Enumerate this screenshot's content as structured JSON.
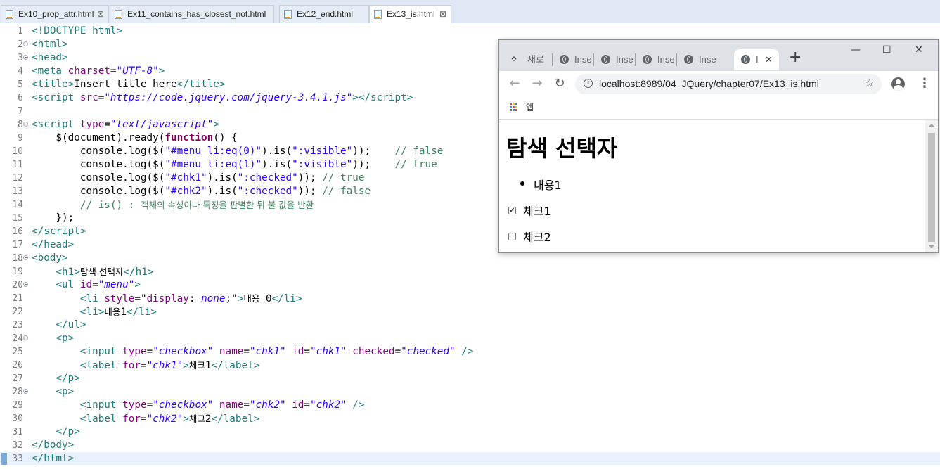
{
  "editor_tabs": [
    {
      "label": "Ex10_prop_attr.html",
      "close": "⊠"
    },
    {
      "label": "Ex11_contains_has_closest_not.html"
    },
    {
      "label": "Ex12_end.html"
    },
    {
      "label": "Ex13_is.html",
      "close": "⊠",
      "active": true
    }
  ],
  "editor": {
    "line_numbers": [
      "1",
      "2",
      "3",
      "4",
      "5",
      "6",
      "7",
      "8",
      "9",
      "10",
      "11",
      "12",
      "13",
      "14",
      "15",
      "16",
      "17",
      "18",
      "19",
      "20",
      "21",
      "22",
      "23",
      "24",
      "25",
      "26",
      "27",
      "28",
      "29",
      "30",
      "31",
      "32",
      "33"
    ],
    "current_line": "33"
  },
  "browser": {
    "tabs": [
      {
        "label": "새로",
        "icon": "apps-dots-icon"
      },
      {
        "label": "Inse",
        "icon": "globe-icon"
      },
      {
        "label": "Inse",
        "icon": "globe-icon"
      },
      {
        "label": "Inse",
        "icon": "globe-icon"
      },
      {
        "label": "Inse",
        "icon": "globe-icon"
      },
      {
        "label": "I",
        "icon": "globe-icon",
        "active": true,
        "close": "✕"
      }
    ],
    "new_tab": "+",
    "window_controls": {
      "minimize": "—",
      "maximize": "☐",
      "close": "✕"
    },
    "nav": {
      "back": "←",
      "forward": "→",
      "reload": "↻"
    },
    "url": "localhost:8989/04_JQuery/chapter07/Ex13_is.html",
    "info_glyph": "i",
    "star": "☆",
    "menu": "⋮",
    "bookmarks_label": "앱",
    "page": {
      "h1": "탐색 선택자",
      "list_item": "내용1",
      "chk1_label": "체크1",
      "chk1_checked": true,
      "chk1_mark": "✔",
      "chk2_label": "체크2",
      "chk2_checked": false
    }
  },
  "colors": {
    "tag": "#1d7a7a",
    "attr": "#7f007f",
    "value": "#2a00ff",
    "keyword": "#7f0055",
    "comment": "#3f7f5f"
  }
}
